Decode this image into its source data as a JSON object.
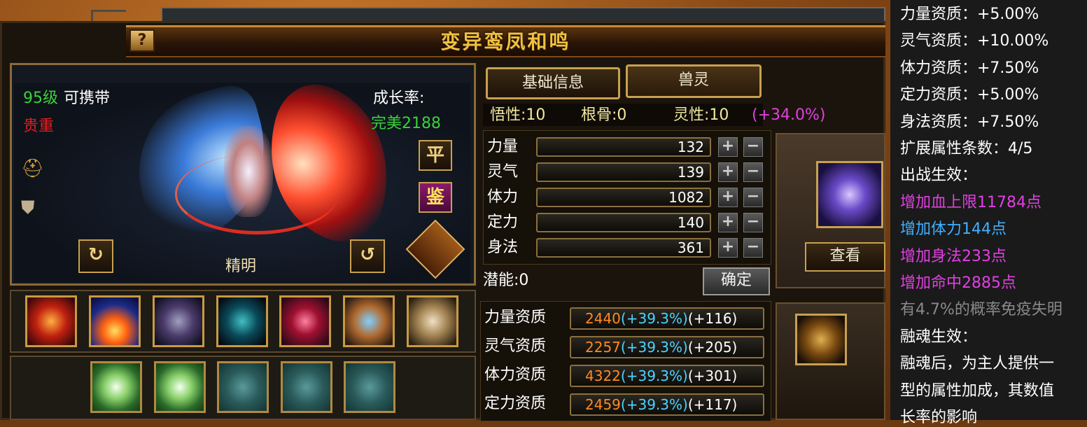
{
  "window": {
    "title": "变异鸾凤和鸣",
    "help_label": "?"
  },
  "pet": {
    "level": "95级",
    "carry": "可携带",
    "rarity": "贵重",
    "growth_label": "成长率:",
    "growth_value": "完美2188",
    "personality": "精明",
    "btn_ping": "平",
    "btn_jian": "鉴"
  },
  "tabs": [
    {
      "label": "基础信息"
    },
    {
      "label": "兽灵"
    }
  ],
  "innate": {
    "wuxing": "悟性:10",
    "gengu": "根骨:0",
    "lingxing": "灵性:10",
    "bonus": "(+34.0%)"
  },
  "stats": [
    {
      "label": "力量",
      "value": "132"
    },
    {
      "label": "灵气",
      "value": "139"
    },
    {
      "label": "体力",
      "value": "1082"
    },
    {
      "label": "定力",
      "value": "140"
    },
    {
      "label": "身法",
      "value": "361"
    }
  ],
  "plus": "+",
  "minus": "−",
  "potential": "潜能:0",
  "confirm": "确定",
  "view": "查看",
  "aptitudes": [
    {
      "label": "力量资质",
      "base": "2440",
      "pct": "(+39.3%)",
      "add": "(+116)"
    },
    {
      "label": "灵气资质",
      "base": "2257",
      "pct": "(+39.3%)",
      "add": "(+205)"
    },
    {
      "label": "体力资质",
      "base": "4322",
      "pct": "(+39.3%)",
      "add": "(+301)"
    },
    {
      "label": "定力资质",
      "base": "2459",
      "pct": "(+39.3%)",
      "add": "(+117)"
    }
  ],
  "tooltip": {
    "lines": [
      "力量资质：+5.00%",
      "灵气资质：+10.00%",
      "体力资质：+7.50%",
      "定力资质：+5.00%",
      "身法资质：+7.50%",
      "扩展属性条数：4/5",
      "出战生效："
    ],
    "effects": [
      {
        "text": "增加血上限11784点",
        "color": "#e040e0"
      },
      {
        "text": "增加体力144点",
        "color": "#40b0ff"
      },
      {
        "text": "增加身法233点",
        "color": "#e040e0"
      },
      {
        "text": "增加命中2885点",
        "color": "#e040e0"
      }
    ],
    "note": "有4.7%的概率免疫失明",
    "fusion_title": "融魂生效：",
    "fusion_lines": [
      "融魂后，为主人提供一",
      "型的属性加成，其数值",
      "长率的影响"
    ]
  }
}
